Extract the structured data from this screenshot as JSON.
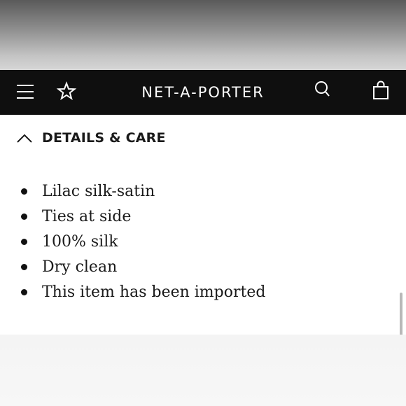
{
  "header": {
    "brand": "NET-A-PORTER",
    "icons": {
      "menu": "hamburger-menu-icon",
      "wishlist": "star-icon",
      "search": "search-icon",
      "bag": "shopping-bag-icon"
    }
  },
  "details": {
    "title": "DETAILS & CARE",
    "expanded": true,
    "items": [
      "Lilac silk-satin",
      "Ties at side",
      "100% silk",
      "Dry clean",
      "This item has been imported"
    ]
  },
  "colors": {
    "navbar": "#0f0f0f",
    "text": "#1a1a1a",
    "background": "#ffffff"
  }
}
